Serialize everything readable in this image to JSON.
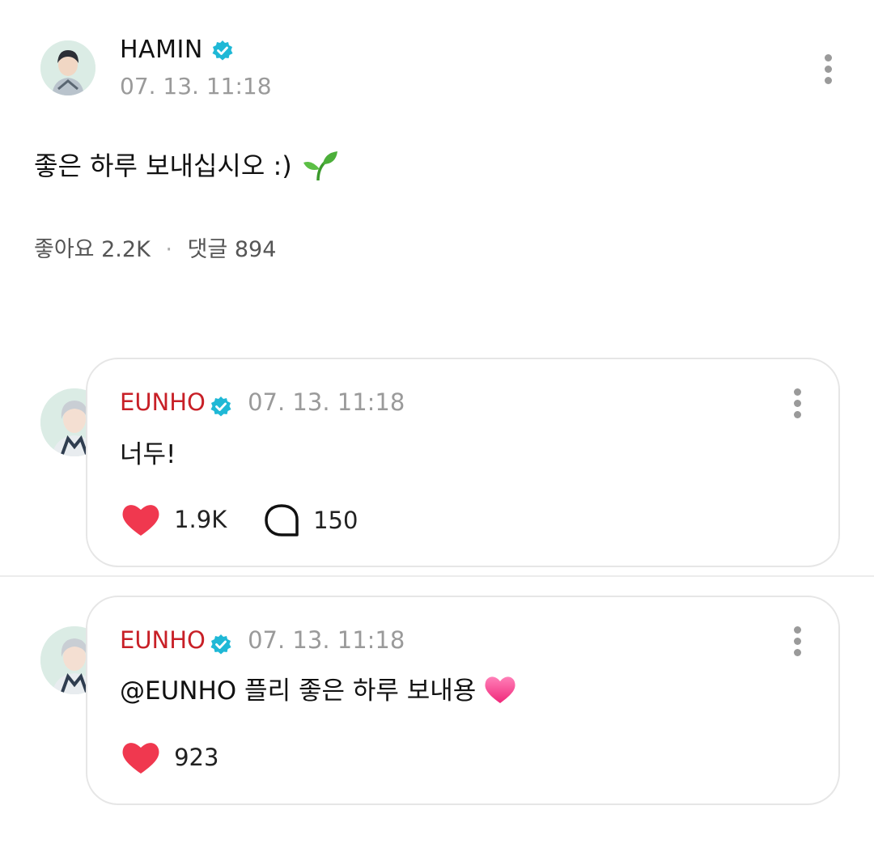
{
  "post": {
    "author": "HAMIN",
    "time": "07. 13. 11:18",
    "body": "좋은 하루 보내십시오 :)",
    "emoji": "🌱",
    "likes_label": "좋아요",
    "likes_count": "2.2K",
    "comments_label": "댓글",
    "comments_count": "894"
  },
  "comments": [
    {
      "author": "EUNHO",
      "time": "07. 13. 11:18",
      "text": "너두!",
      "likes": "1.9K",
      "replies": "150"
    },
    {
      "author": "EUNHO",
      "time": "07. 13. 11:18",
      "mention": "@EUNHO",
      "text": "플리 좋은 하루 보내용",
      "likes": "923"
    }
  ],
  "colors": {
    "verified": "#1fb8d6",
    "name_red": "#c82027",
    "heart": "#f0384f"
  },
  "icons": [
    "verified-badge-icon",
    "more-vertical-icon",
    "heart-icon",
    "comment-bubble-icon",
    "sprout-icon",
    "pink-heart-icon"
  ]
}
